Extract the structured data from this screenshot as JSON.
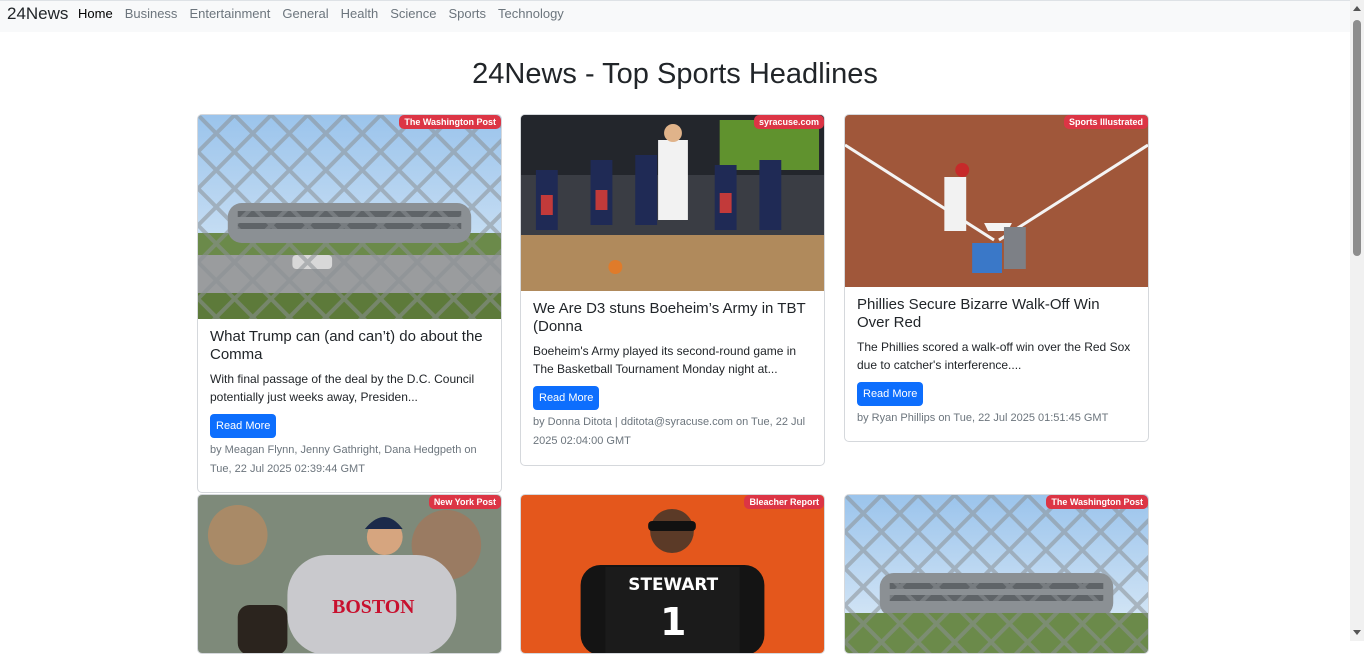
{
  "navbar": {
    "brand": "24News",
    "links": [
      "Home",
      "Business",
      "Entertainment",
      "General",
      "Health",
      "Science",
      "Sports",
      "Technology"
    ]
  },
  "page": {
    "heading": "24News - Top Sports Headlines"
  },
  "cards": [
    {
      "source": "The Washington Post",
      "title": "What Trump can (and can’t) do about the Comma",
      "desc": "With final passage of the deal by the D.C. Council potentially just weeks away, Presiden...",
      "button": "Read More",
      "byline": "by Meagan Flynn, Jenny Gathright, Dana Hedgpeth on Tue, 22 Jul 2025 02:39:44 GMT",
      "image": "stadium-behind-fence"
    },
    {
      "source": "syracuse.com",
      "title": "We Are D3 stuns Boeheim’s Army in TBT (Donna",
      "desc": "Boeheim's Army played its second-round game in The Basketball Tournament Monday night at...",
      "button": "Read More",
      "byline": "by Donna Ditota | dditota@syracuse.com on Tue, 22 Jul 2025 02:04:00 GMT",
      "image": "basketball-game"
    },
    {
      "source": "Sports Illustrated",
      "title": "Phillies Secure Bizarre Walk-Off Win Over Red",
      "desc": "The Phillies scored a walk-off win over the Red Sox due to catcher's interference....",
      "button": "Read More",
      "byline": "by Ryan Phillips on Tue, 22 Jul 2025 01:51:45 GMT",
      "image": "baseball-home-plate"
    },
    {
      "source": "New York Post",
      "image": "boston-pitcher"
    },
    {
      "source": "Bleacher Report",
      "image": "football-jersey-stewart"
    },
    {
      "source": "The Washington Post",
      "image": "stadium-behind-fence"
    }
  ]
}
